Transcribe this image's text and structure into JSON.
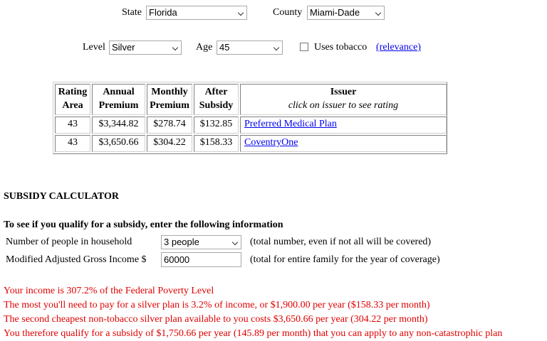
{
  "filters": {
    "state_label": "State",
    "state_value": "Florida",
    "county_label": "County",
    "county_value": "Miami-Dade",
    "level_label": "Level",
    "level_value": "Silver",
    "age_label": "Age",
    "age_value": "45",
    "tobacco_label": "Uses tobacco",
    "relevance_link": "(relevance)"
  },
  "table": {
    "headers": {
      "rating_line1": "Rating",
      "rating_line2": "Area",
      "annual_line1": "Annual",
      "annual_line2": "Premium",
      "monthly_line1": "Monthly",
      "monthly_line2": "Premium",
      "after_line1": "After",
      "after_line2": "Subsidy",
      "issuer_line1": "Issuer",
      "issuer_line2": "click on issuer to see rating"
    },
    "rows": [
      {
        "rating_area": "43",
        "annual": "$3,344.82",
        "monthly": "$278.74",
        "after_subsidy": "$132.85",
        "issuer": "Preferred Medical Plan"
      },
      {
        "rating_area": "43",
        "annual": "$3,650.66",
        "monthly": "$304.22",
        "after_subsidy": "$158.33",
        "issuer": "CoventryOne"
      }
    ]
  },
  "calculator": {
    "title": "SUBSIDY CALCULATOR",
    "intro": "To see if you qualify for a subsidy, enter the following information",
    "people_label": "Number of people in household",
    "people_value": "3 people",
    "people_note": "(total number, even if not all will be covered)",
    "income_label": "Modified Adjusted Gross Income $",
    "income_value": "60000",
    "income_note": "(total for entire family for the year of coverage)"
  },
  "results": {
    "line1": "Your income is 307.2% of the Federal Poverty Level",
    "line2": "The most you'll need to pay for a silver plan is 3.2% of income, or $1,900.00 per year ($158.33 per month)",
    "line3": "The second cheapest non-tobacco silver plan available to you costs $3,650.66 per year (304.22 per month)",
    "line4": "You therefore qualify for a subsidy of $1,750.66 per year (145.89 per month) that you can apply to any non-catastrophic plan",
    "text_color": "#e00000"
  }
}
